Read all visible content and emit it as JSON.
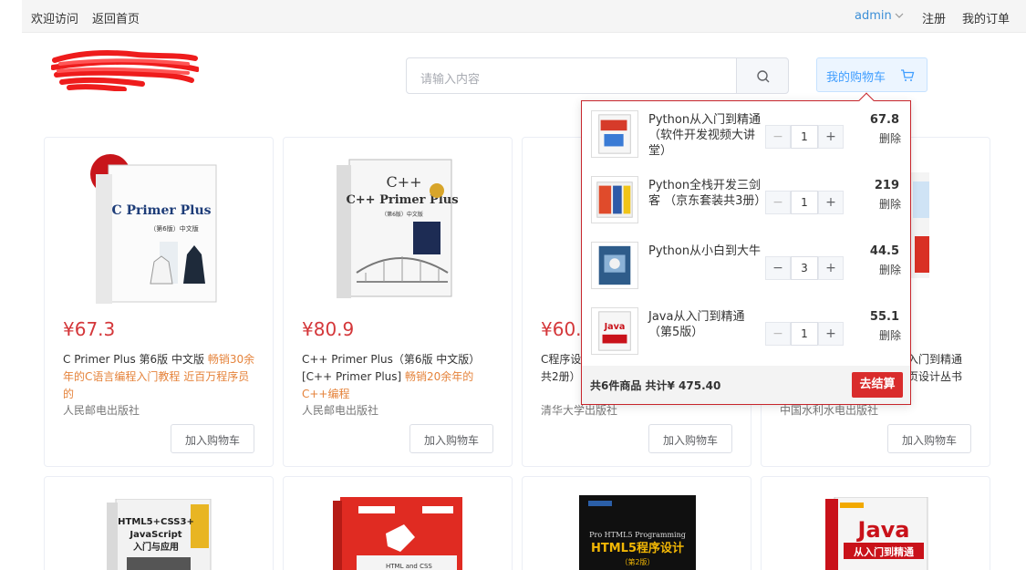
{
  "topbar": {
    "welcome": "欢迎访问",
    "home": "返回首页",
    "user": "admin",
    "register": "注册",
    "orders": "我的订单"
  },
  "search": {
    "placeholder": "请输入内容"
  },
  "cart_button": {
    "label": "我的购物车"
  },
  "products": [
    {
      "price": "¥67.3",
      "title": "C Primer Plus 第6版 中文版 ",
      "highlight": "畅销30余年的C语言编程入门教程 近百万程序员的",
      "publisher": "人民邮电出版社",
      "add_label": "加入购物车",
      "cover_title": "C Primer Plus",
      "cover_sub": "（第6版）中文版"
    },
    {
      "price": "¥80.9",
      "title": "C++ Primer Plus（第6版 中文版）[C++ Primer Plus] ",
      "highlight": "畅销20余年的C++编程",
      "publisher": "人民邮电出版社",
      "add_label": "加入购物车",
      "cover_title": "C++ Primer Plus",
      "cover_sub": "（第6版）中文版"
    },
    {
      "price": "¥60.",
      "title": "C程序设",
      "highlight": "",
      "title2": "共2册）",
      "publisher": "清华大学出版社",
      "add_label": "加入购物车"
    },
    {
      "price": "",
      "title": "入门到精通",
      "highlight": "",
      "title2": "页设计丛书",
      "publisher": "中国水利水电出版社",
      "add_label": "加入购物车"
    }
  ],
  "products_row2": [
    {
      "cover_title": "HTML5+CSS3+ JavaScript 入门与应用"
    },
    {
      "cover_title": "HTML and CSS"
    },
    {
      "cover_title": "HTML5程序设计",
      "cover_sub": "（第2版）",
      "cover_top": "Pro HTML5 Programming"
    },
    {
      "cover_title": "Java",
      "cover_sub": "从入门到精通"
    }
  ],
  "cart_popup": {
    "items": [
      {
        "name": "Python从入门到精通（软件开发视频大讲堂）",
        "qty": "1",
        "amount": "67.8",
        "delete_label": "删除"
      },
      {
        "name": "Python全栈开发三剑客 （京东套装共3册）",
        "qty": "1",
        "amount": "219",
        "delete_label": "删除"
      },
      {
        "name": "Python从小白到大牛",
        "qty": "3",
        "amount": "44.5",
        "delete_label": "删除"
      },
      {
        "name": "Java从入门到精通（第5版）",
        "qty": "1",
        "amount": "55.1",
        "delete_label": "删除"
      }
    ],
    "minus": "−",
    "plus": "+",
    "summary": "共6件商品 共计¥ 475.40",
    "checkout_label": "去结算"
  },
  "colors": {
    "price": "#d4373a",
    "accent": "#409eff",
    "highlight": "#e5833b",
    "checkout": "#d92c2c"
  }
}
